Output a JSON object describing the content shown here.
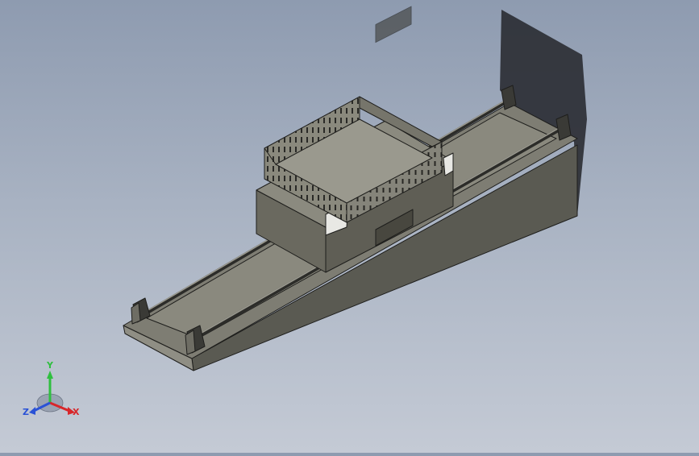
{
  "view": {
    "background_top": "#8e9bb0",
    "background_bottom": "#c4cad5",
    "model_color": "#7c7b6f",
    "edge_color": "#1e1e1c"
  },
  "triad": {
    "y_label": "Y",
    "x_label": "X",
    "z_label": "Z",
    "y_color": "#2fbf3f",
    "x_color": "#d8262a",
    "z_color": "#2a52d6"
  }
}
